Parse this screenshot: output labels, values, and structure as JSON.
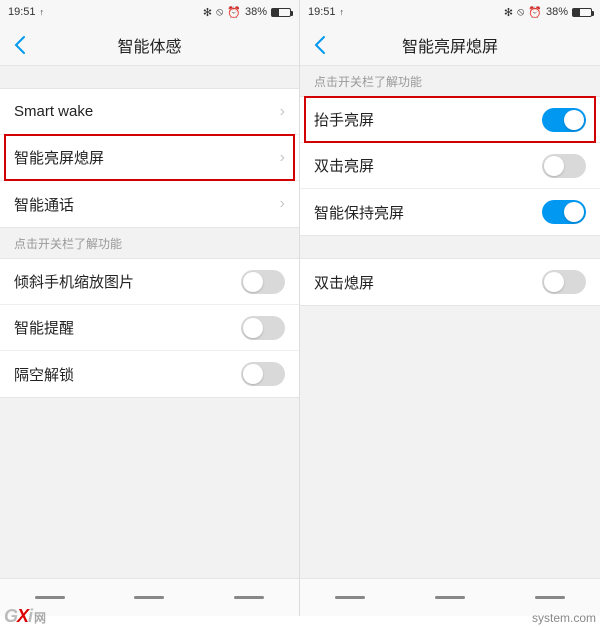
{
  "status": {
    "time": "19:51",
    "upload": "↑",
    "bluetooth": "⌔",
    "dnd": "⊘",
    "alarm": "⏰",
    "battery_pct": "38%"
  },
  "left": {
    "title": "智能体感",
    "group1": [
      {
        "label": "Smart wake",
        "type": "nav",
        "highlight": false
      },
      {
        "label": "智能亮屏熄屏",
        "type": "nav",
        "highlight": true
      },
      {
        "label": "智能通话",
        "type": "nav",
        "highlight": false
      }
    ],
    "section_label": "点击开关栏了解功能",
    "group2": [
      {
        "label": "倾斜手机缩放图片",
        "type": "toggle",
        "on": false
      },
      {
        "label": "智能提醒",
        "type": "toggle",
        "on": false
      },
      {
        "label": "隔空解锁",
        "type": "toggle",
        "on": false
      }
    ]
  },
  "right": {
    "title": "智能亮屏熄屏",
    "section_label": "点击开关栏了解功能",
    "group1": [
      {
        "label": "抬手亮屏",
        "type": "toggle",
        "on": true,
        "highlight": true
      },
      {
        "label": "双击亮屏",
        "type": "toggle",
        "on": false
      },
      {
        "label": "智能保持亮屏",
        "type": "toggle",
        "on": true
      }
    ],
    "group2": [
      {
        "label": "双击熄屏",
        "type": "toggle",
        "on": false
      }
    ]
  },
  "watermark": {
    "left_prefix": "G",
    "left_x": "X",
    "left_i": "i",
    "left_suffix": "网",
    "right": "system.com"
  }
}
